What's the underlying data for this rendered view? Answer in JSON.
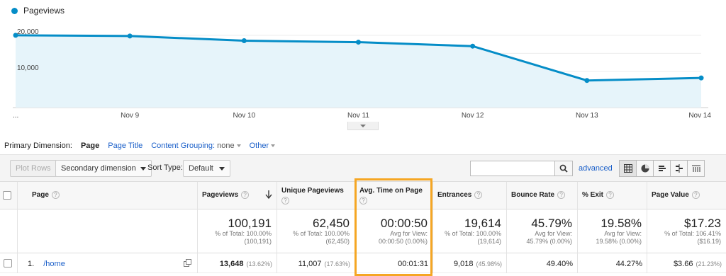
{
  "legend": {
    "label": "Pageviews"
  },
  "chart_data": {
    "type": "area",
    "series": [
      {
        "name": "Pageviews",
        "values": [
          20000,
          19800,
          18500,
          18100,
          17000,
          7500,
          8200
        ]
      }
    ],
    "x_tick_labels": [
      "...",
      "Nov 9",
      "Nov 10",
      "Nov 11",
      "Nov 12",
      "Nov 13",
      "Nov 14"
    ],
    "y_tick_labels": [
      "20,000",
      "10,000"
    ],
    "y_ticks": [
      20000,
      10000
    ],
    "ylim": [
      0,
      23500
    ],
    "grid": true,
    "colors": {
      "line": "#058dc7",
      "fill": "#e6f4fa"
    }
  },
  "dimension_bar": {
    "label": "Primary Dimension:",
    "active": "Page",
    "page_title": "Page Title",
    "content_grouping_label": "Content Grouping:",
    "content_grouping_value": "none",
    "other": "Other"
  },
  "toolbar": {
    "plot_rows": "Plot Rows",
    "secondary_dimension": "Secondary dimension",
    "sort_type_label": "Sort Type:",
    "sort_type_value": "Default",
    "search_placeholder": "",
    "advanced": "advanced"
  },
  "table": {
    "headers": {
      "page": "Page",
      "pageviews": "Pageviews",
      "unique_pageviews": "Unique Pageviews",
      "avg_time": "Avg. Time on Page",
      "entrances": "Entrances",
      "bounce_rate": "Bounce Rate",
      "exit": "% Exit",
      "page_value": "Page Value"
    },
    "totals": {
      "pageviews": {
        "value": "100,191",
        "line1": "% of Total: 100.00%",
        "line2": "(100,191)"
      },
      "unique_pageviews": {
        "value": "62,450",
        "line1": "% of Total: 100.00%",
        "line2": "(62,450)"
      },
      "avg_time": {
        "value": "00:00:50",
        "line1": "Avg for View:",
        "line2": "00:00:50 (0.00%)"
      },
      "entrances": {
        "value": "19,614",
        "line1": "% of Total: 100.00%",
        "line2": "(19,614)"
      },
      "bounce_rate": {
        "value": "45.79%",
        "line1": "Avg for View:",
        "line2": "45.79% (0.00%)"
      },
      "exit": {
        "value": "19.58%",
        "line1": "Avg for View:",
        "line2": "19.58% (0.00%)"
      },
      "page_value": {
        "value": "$17.23",
        "line1": "% of Total: 106.41%",
        "line2": "($16.19)"
      }
    },
    "rows": [
      {
        "index": "1.",
        "page": "/home",
        "pageviews": "13,648",
        "pageviews_pct": "(13.62%)",
        "unique_pageviews": "11,007",
        "unique_pageviews_pct": "(17.63%)",
        "avg_time": "00:01:31",
        "entrances": "9,018",
        "entrances_pct": "(45.98%)",
        "bounce_rate": "49.40%",
        "exit": "44.27%",
        "page_value": "$3.66",
        "page_value_pct": "(21.23%)"
      }
    ]
  }
}
